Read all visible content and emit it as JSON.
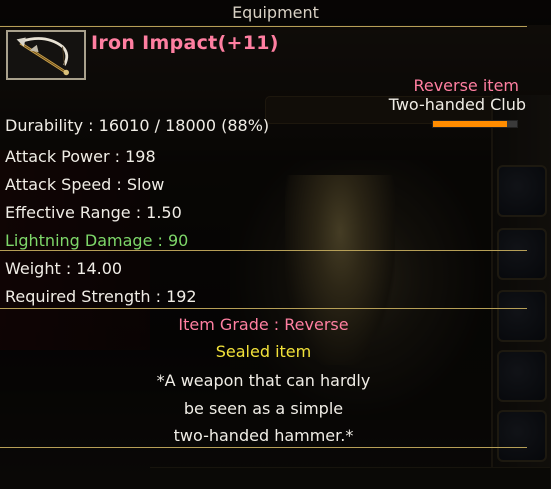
{
  "window": {
    "title": "Equipment"
  },
  "item": {
    "icon": "crossbow-hammer-icon",
    "name": "Iron Impact(+11)",
    "rarity_label": "Reverse item",
    "type": "Two-handed Club",
    "durability_text": "Durability : 16010 / 18000 (88%)",
    "durability_fraction": 0.88,
    "stats": {
      "attack_power": "Attack Power : 198",
      "attack_speed": "Attack Speed : Slow",
      "effective_range": "Effective Range : 1.50",
      "lightning_damage": "Lightning Damage : 90",
      "weight": "Weight : 14.00",
      "required_strength": "Required Strength : 192"
    },
    "grade": "Item Grade : Reverse",
    "sealed": "Sealed item",
    "description": [
      "*A weapon that can hardly",
      "be seen as a simple",
      "two-handed hammer.*"
    ]
  },
  "colors": {
    "name_pink": "#ff7fa1",
    "lightning_green": "#7ed86a",
    "sealed_yellow": "#f2e23a",
    "durability_orange": "#ff8c00",
    "rule_gold": "#b69f57"
  }
}
